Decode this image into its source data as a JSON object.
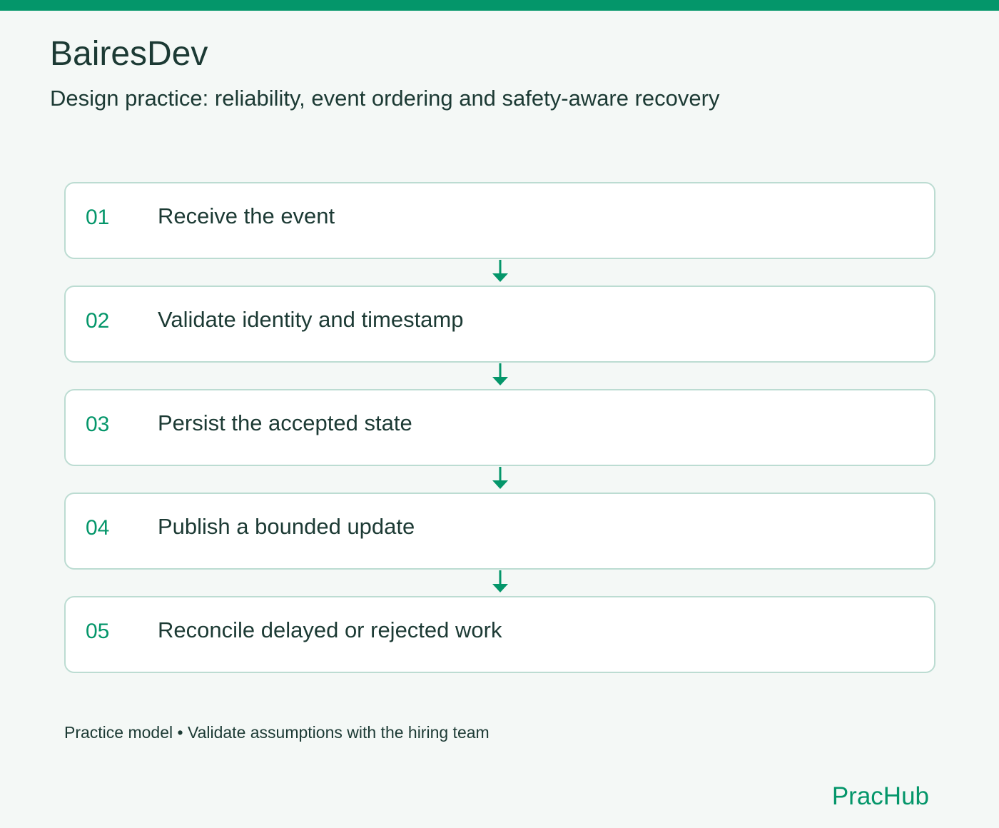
{
  "header": {
    "title": "BairesDev",
    "subtitle": "Design practice: reliability, event ordering and safety-aware recovery"
  },
  "steps": [
    {
      "number": "01",
      "label": "Receive the event"
    },
    {
      "number": "02",
      "label": "Validate identity and timestamp"
    },
    {
      "number": "03",
      "label": "Persist the accepted state"
    },
    {
      "number": "04",
      "label": "Publish a bounded update"
    },
    {
      "number": "05",
      "label": "Reconcile delayed or rejected work"
    }
  ],
  "footer": {
    "note": "Practice model • Validate assumptions with the hiring team",
    "brand": "PracHub"
  },
  "colors": {
    "accent": "#04966a",
    "text": "#1c3a34",
    "background": "#f4f8f6",
    "card_border": "#bcdcd2",
    "card_background": "#ffffff"
  },
  "icons": {
    "connector": "arrow-down-icon"
  }
}
